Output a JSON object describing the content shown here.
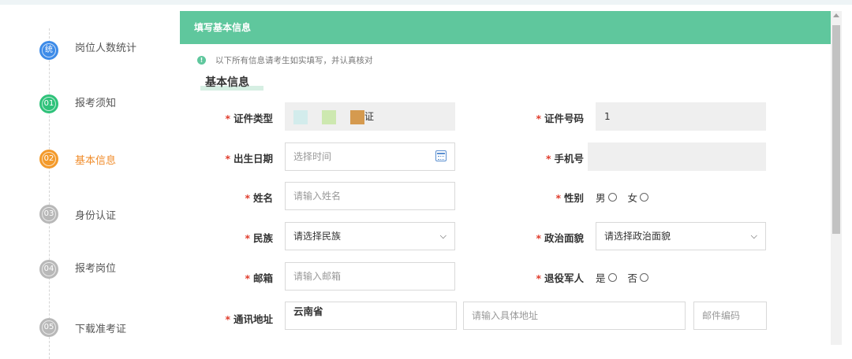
{
  "sidebar": {
    "steps": [
      {
        "badge": "统",
        "label": "岗位人数统计",
        "color": "#3d8be8"
      },
      {
        "badge": "01",
        "label": "报考须知",
        "color": "#2fc27a"
      },
      {
        "badge": "02",
        "label": "基本信息",
        "color": "#f39a2b"
      },
      {
        "badge": "03",
        "label": "身份认证",
        "color": "#b8b8b8"
      },
      {
        "badge": "04",
        "label": "报考岗位",
        "color": "#b8b8b8"
      },
      {
        "badge": "05",
        "label": "下载准考证",
        "color": "#b8b8b8"
      }
    ]
  },
  "header": {
    "title": "填写基本信息"
  },
  "notice": {
    "icon": "info-icon",
    "text": "以下所有信息请考生如实填写，并认真核对"
  },
  "section": {
    "title": "基本信息"
  },
  "required_mark": "*",
  "form": {
    "id_type": {
      "label": "证件类型",
      "value_suffix": "证"
    },
    "id_number": {
      "label": "证件号码",
      "value": "1"
    },
    "birth_date": {
      "label": "出生日期",
      "placeholder": "选择时间"
    },
    "phone": {
      "label": "手机号",
      "value": ""
    },
    "name": {
      "label": "姓名",
      "placeholder": "请输入姓名"
    },
    "gender": {
      "label": "性别",
      "options": [
        "男",
        "女"
      ]
    },
    "ethnicity": {
      "label": "民族",
      "selected": "请选择民族"
    },
    "political": {
      "label": "政治面貌",
      "selected": "请选择政治面貌"
    },
    "email": {
      "label": "邮箱",
      "placeholder": "请输入邮箱"
    },
    "veteran": {
      "label": "退役军人",
      "options": [
        "是",
        "否"
      ]
    },
    "address": {
      "label": "通讯地址",
      "province": "云南省",
      "detail_placeholder": "请输入具体地址",
      "postcode_placeholder": "邮件编码"
    }
  },
  "colors": {
    "accent": "#5fc79d",
    "active_step": "#f08c2a",
    "required": "#e03c2c"
  }
}
